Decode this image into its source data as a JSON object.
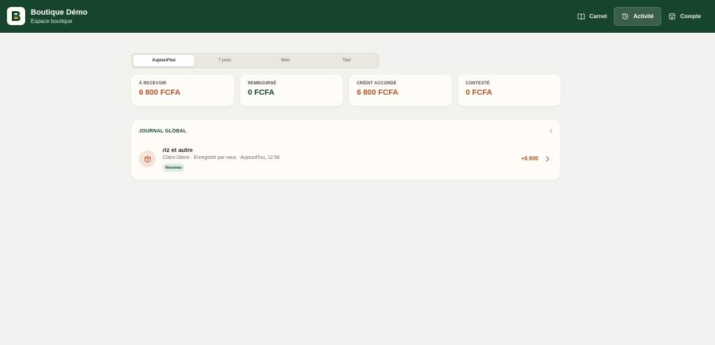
{
  "header": {
    "brand_title": "Boutique Démo",
    "brand_subtitle": "Espace boutique",
    "logo_letter": "B",
    "nav": [
      {
        "label": "Carnet",
        "icon": "book-open-icon"
      },
      {
        "label": "Activité",
        "icon": "history-icon",
        "active": true
      },
      {
        "label": "Compte",
        "icon": "store-icon"
      }
    ]
  },
  "period_tabs": {
    "items": [
      "Aujourd'hui",
      "7 jours",
      "Mois",
      "Tout"
    ],
    "selected": "Aujourd'hui"
  },
  "summary_cards": [
    {
      "label": "À RECEVOIR",
      "value": "6 800 FCFA",
      "color": "#b4532a"
    },
    {
      "label": "REMBOURSÉ",
      "value": "0 FCFA",
      "color": "#17452c"
    },
    {
      "label": "CRÉDIT ACCORDÉ",
      "value": "6 800 FCFA",
      "color": "#b4532a"
    },
    {
      "label": "CONTESTÉ",
      "value": "0 FCFA",
      "color": "#b4532a"
    }
  ],
  "journal": {
    "title": "JOURNAL GLOBAL",
    "count": "1",
    "entries": [
      {
        "title": "riz et autre",
        "meta": "Client Démo · Enregistré par vous · Aujourd'hui, 12:58",
        "badge": "Nouveau",
        "amount": "+6 800",
        "icon": "package-icon"
      }
    ]
  },
  "colors": {
    "primary": "#17452c",
    "accent": "#b4532a",
    "background": "#f2f2ee",
    "card": "#fdfcf7"
  }
}
